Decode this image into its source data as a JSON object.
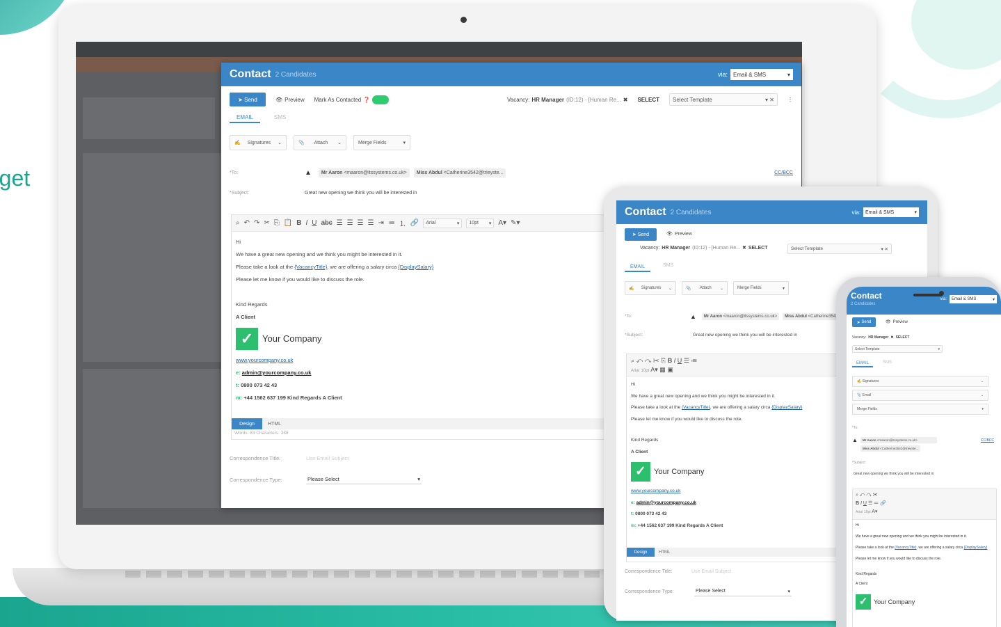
{
  "background": {
    "side_text": "rget",
    "accent": "#1aa58f"
  },
  "modal": {
    "title": "Contact",
    "subtitle": "2 Candidates",
    "via_label": "via:",
    "via_value": "Email & SMS",
    "send_label": "Send",
    "preview_label": "Preview",
    "mark_contacted_label": "Mark As Contacted",
    "vacancy_label": "Vacancy:",
    "vacancy_value": "HR Manager",
    "vacancy_detail": "(ID:12) - [Human Re...",
    "select_label": "SELECT",
    "template_placeholder": "Select Template",
    "tabs": [
      "EMAIL",
      "SMS"
    ],
    "signatures_label": "Signatures",
    "attach_label": "Attach",
    "email_label": "Email",
    "merge_fields_label": "Merge Fields",
    "to_label": "*To:",
    "recipients": [
      {
        "name": "Mr Aaron",
        "email": "<maaron@itssystems.co.uk>"
      },
      {
        "name": "Miss Abdul",
        "email": "<Catherine3542@trieyste..."
      }
    ],
    "ccbcc_label": "CC/BCC",
    "subject_label": "*Subject:",
    "subject_value": "Great new opening we think you will be interested in",
    "font_name": "Arial",
    "font_size": "10pt",
    "body": {
      "greeting": "Hi",
      "line1": "We have a great new opening and we think you might be interested in it.",
      "line2_prefix": "Please take a look at the",
      "line2_merge1": "{VacancyTitle}",
      "line2_mid": ", we are offering a salary circa",
      "line2_merge2": "{DisplaySalary}",
      "line3": "Please let me know if you would like to discuss the role.",
      "regards": "Kind Regards",
      "signoff": "A Client",
      "company": "Your Company",
      "website": "www.yourcompany.co.uk",
      "email_prefix": "e:",
      "email": "admin@yourcompany.co.uk",
      "tel_prefix": "t:",
      "tel": "0800 073 42 43",
      "mobile_prefix": "m:",
      "mobile": "+44 1562 637 199 Kind Regards A Client"
    },
    "design_label": "Design",
    "html_label": "HTML",
    "stats": "Words: 63   Characters: 388",
    "corr_title_label": "Correspondence Title:",
    "corr_title_placeholder": "Use Email Subject",
    "corr_type_label": "Correspondence Type:",
    "corr_type_value": "Please Select"
  }
}
